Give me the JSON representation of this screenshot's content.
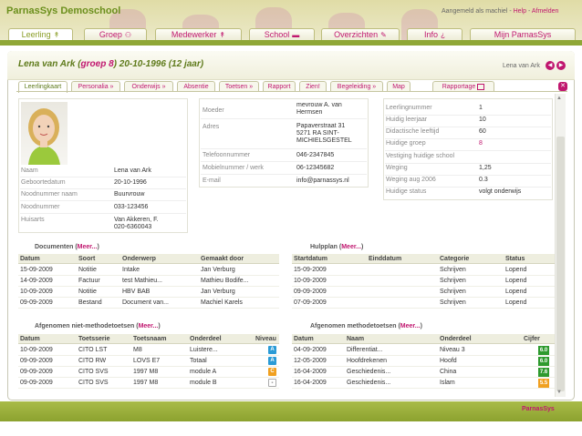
{
  "header": {
    "app_title": "ParnasSys Demoschool",
    "login_prefix": "Aangemeld als machiel - ",
    "help": "Help",
    "sep": " - ",
    "logout": "Afmelden"
  },
  "main_tabs": [
    {
      "label": "Leerling",
      "glyph": "↟"
    },
    {
      "label": "Groep",
      "glyph": "⚇"
    },
    {
      "label": "Medewerker",
      "glyph": "↟"
    },
    {
      "label": "School",
      "glyph": "▬"
    },
    {
      "label": "Overzichten",
      "glyph": "✎"
    },
    {
      "label": "Info",
      "glyph": "¿"
    },
    {
      "label": "Mijn ParnasSys",
      "glyph": ""
    }
  ],
  "student": {
    "name": "Lena van Ark (",
    "group": "groep 8",
    "rest": ") 20-10-1996 (12 jaar)",
    "nav_label": "Lena van Ark"
  },
  "sub_tabs": [
    "Leerlingkaart",
    "Personalia »",
    "Onderwijs »",
    "Absentie",
    "Toetsen »",
    "Rapport",
    "Zien!",
    "Begeleiding »",
    "Map",
    "Rapportage"
  ],
  "personal": {
    "rows": [
      {
        "label": "Naam",
        "value": "Lena van Ark"
      },
      {
        "label": "Geboortedatum",
        "value": "20-10-1996"
      },
      {
        "label": "Noodnummer naam",
        "value": "Buurvrouw"
      },
      {
        "label": "Noodnummer",
        "value": "033-123456"
      },
      {
        "label": "Huisarts",
        "value": "Van Akkeren, F."
      },
      {
        "label": "",
        "value": "020-6360043"
      }
    ]
  },
  "contact": {
    "rows": [
      {
        "label": "Moeder",
        "value": "mevrouw A. van"
      },
      {
        "label": "",
        "value": "Hermsen"
      },
      {
        "label": "Adres",
        "value": "Papaverstraat 31"
      },
      {
        "label": "",
        "value": "5271 RA SINT-"
      },
      {
        "label": "",
        "value": "MICHIELSGESTEL"
      },
      {
        "label": "Telefoonnummer",
        "value": "046-2347845"
      },
      {
        "label": "Mobielnummer / werk",
        "value": "06-12345682"
      },
      {
        "label": "E-mail",
        "value": "info@parnassys.nl"
      }
    ]
  },
  "school_info": {
    "rows": [
      {
        "label": "Leerlingnummer",
        "value": "1"
      },
      {
        "label": "Huidig leerjaar",
        "value": "10"
      },
      {
        "label": "Didactische leeftijd",
        "value": "60"
      },
      {
        "label": "Huidige groep",
        "value": "8"
      },
      {
        "label": "Vestiging huidige school",
        "value": ""
      },
      {
        "label": "Weging",
        "value": "1,25"
      },
      {
        "label": "Weging aug 2006",
        "value": "0.3"
      },
      {
        "label": "Huidige status",
        "value": "volgt onderwijs"
      }
    ]
  },
  "documenten": {
    "title": "Documenten (",
    "meer": "Meer...",
    "close": ")",
    "headers": [
      "Datum",
      "Soort",
      "Onderwerp",
      "Gemaakt door"
    ],
    "rows": [
      [
        "15-09-2009",
        "Notitie",
        "Intake",
        "Jan Verburg"
      ],
      [
        "14-09-2009",
        "Factuur",
        "test Mathieu...",
        "Mathieu Bodife..."
      ],
      [
        "10-09-2009",
        "Notitie",
        "HBV BAB",
        "Jan Verburg"
      ],
      [
        "09-09-2009",
        "Bestand",
        "Document van...",
        "Machiel Karels"
      ]
    ]
  },
  "hulpplan": {
    "title": "Hulpplan (",
    "meer": "Meer...",
    "close": ")",
    "headers": [
      "Startdatum",
      "Einddatum",
      "Categorie",
      "Status"
    ],
    "rows": [
      [
        "15-09-2009",
        "",
        "Schrijven",
        "Lopend"
      ],
      [
        "10-09-2009",
        "",
        "Schrijven",
        "Lopend"
      ],
      [
        "09-09-2009",
        "",
        "Schrijven",
        "Lopend"
      ],
      [
        "07-09-2009",
        "",
        "Schrijven",
        "Lopend"
      ]
    ]
  },
  "niet_methode": {
    "title": "Afgenomen niet-methodetoetsen (",
    "meer": "Meer...",
    "close": ")",
    "headers": [
      "Datum",
      "Toetsserie",
      "Toetsnaam",
      "Onderdeel",
      "Niveau"
    ],
    "rows": [
      {
        "cells": [
          "10-09-2009",
          "CITO LST",
          "M8",
          "Luistere..."
        ],
        "level": "A",
        "color": "#2a9bd6"
      },
      {
        "cells": [
          "09-09-2009",
          "CITO RW",
          "LOVS E7",
          "Totaal"
        ],
        "level": "A",
        "color": "#2a9bd6"
      },
      {
        "cells": [
          "09-09-2009",
          "CITO SVS",
          "1997 M8",
          "module A"
        ],
        "level": "C",
        "color": "#f0a020"
      },
      {
        "cells": [
          "09-09-2009",
          "CITO SVS",
          "1997 M8",
          "module B"
        ],
        "level": "-",
        "color": "#ffffff"
      }
    ]
  },
  "methode": {
    "title": "Afgenomen methodetoetsen (",
    "meer": "Meer...",
    "close": ")",
    "headers": [
      "Datum",
      "Naam",
      "Onderdeel",
      "Cijfer"
    ],
    "rows": [
      {
        "cells": [
          "04-09-2009",
          "Differentiat...",
          "Niveau 3"
        ],
        "score": "6.0",
        "color": "#2e9a2e"
      },
      {
        "cells": [
          "12-05-2009",
          "Hoofdrekenen",
          "Hoofd"
        ],
        "score": "6.0",
        "color": "#2e9a2e"
      },
      {
        "cells": [
          "16-04-2009",
          "Geschiedenis...",
          "China"
        ],
        "score": "7.6",
        "color": "#2e9a2e"
      },
      {
        "cells": [
          "16-04-2009",
          "Geschiedenis...",
          "Islam"
        ],
        "score": "5.5",
        "color": "#f0a020"
      }
    ]
  },
  "footer": {
    "logo": "ParnasSys"
  }
}
